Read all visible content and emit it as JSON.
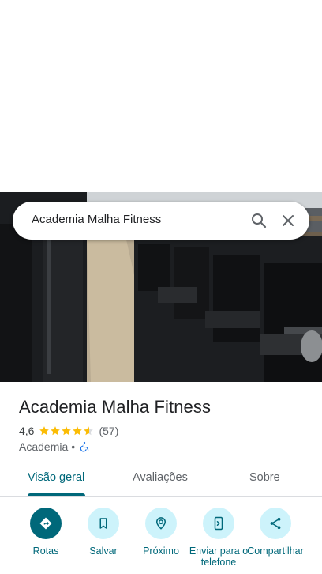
{
  "search": {
    "query": "Academia Malha Fitness"
  },
  "place": {
    "title": "Academia Malha Fitness",
    "rating": "4,6",
    "stars": 4.6,
    "reviews": "(57)",
    "category": "Academia",
    "separator": "•"
  },
  "tabs": [
    {
      "label": "Visão geral",
      "active": true
    },
    {
      "label": "Avaliações",
      "active": false
    },
    {
      "label": "Sobre",
      "active": false
    }
  ],
  "actions": [
    {
      "label": "Rotas",
      "icon": "directions-icon"
    },
    {
      "label": "Salvar",
      "icon": "bookmark-icon"
    },
    {
      "label": "Próximo",
      "icon": "nearby-icon"
    },
    {
      "label": "Enviar para o telefone",
      "icon": "send-to-phone-icon"
    },
    {
      "label": "Compartilhar",
      "icon": "share-icon"
    }
  ],
  "colors": {
    "accent": "#00687a",
    "accent_light": "#cdf3fb",
    "star": "#fbbc04"
  }
}
